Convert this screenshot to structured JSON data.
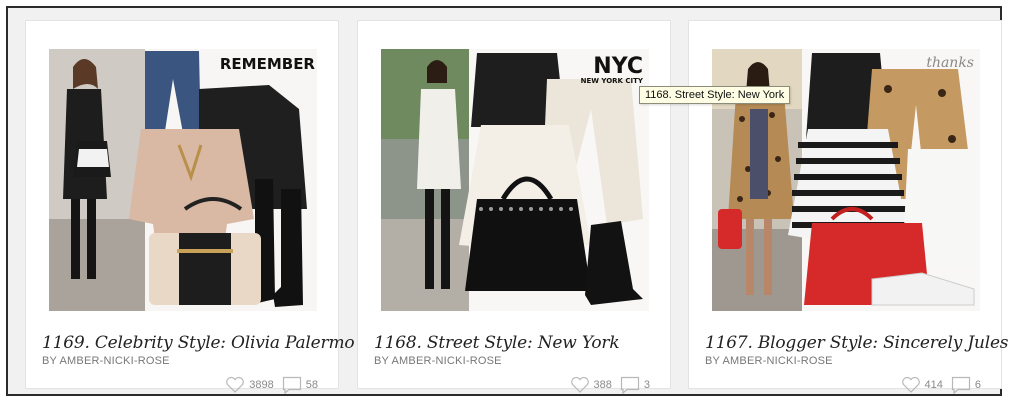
{
  "tooltip": "1168. Street Style: New York",
  "cards": [
    {
      "title": "1169. Celebrity Style: Olivia Palermo",
      "author": "BY AMBER-NICKI-ROSE",
      "likes": "3898",
      "comments": "58",
      "badge": "REMEMBER"
    },
    {
      "title": "1168. Street Style: New York",
      "author": "BY AMBER-NICKI-ROSE",
      "likes": "388",
      "comments": "3",
      "badge": "NYC",
      "badge_sub": "NEW YORK CITY"
    },
    {
      "title": "1167. Blogger Style: Sincerely Jules",
      "author": "BY AMBER-NICKI-ROSE",
      "likes": "414",
      "comments": "6",
      "badge": "thanks"
    }
  ],
  "colors": {
    "accent_red": "#d62a2a",
    "text_dark": "#222222",
    "text_muted": "#777777",
    "tooltip_bg": "#fffde3"
  },
  "icons": [
    "heart-icon",
    "comment-icon"
  ]
}
